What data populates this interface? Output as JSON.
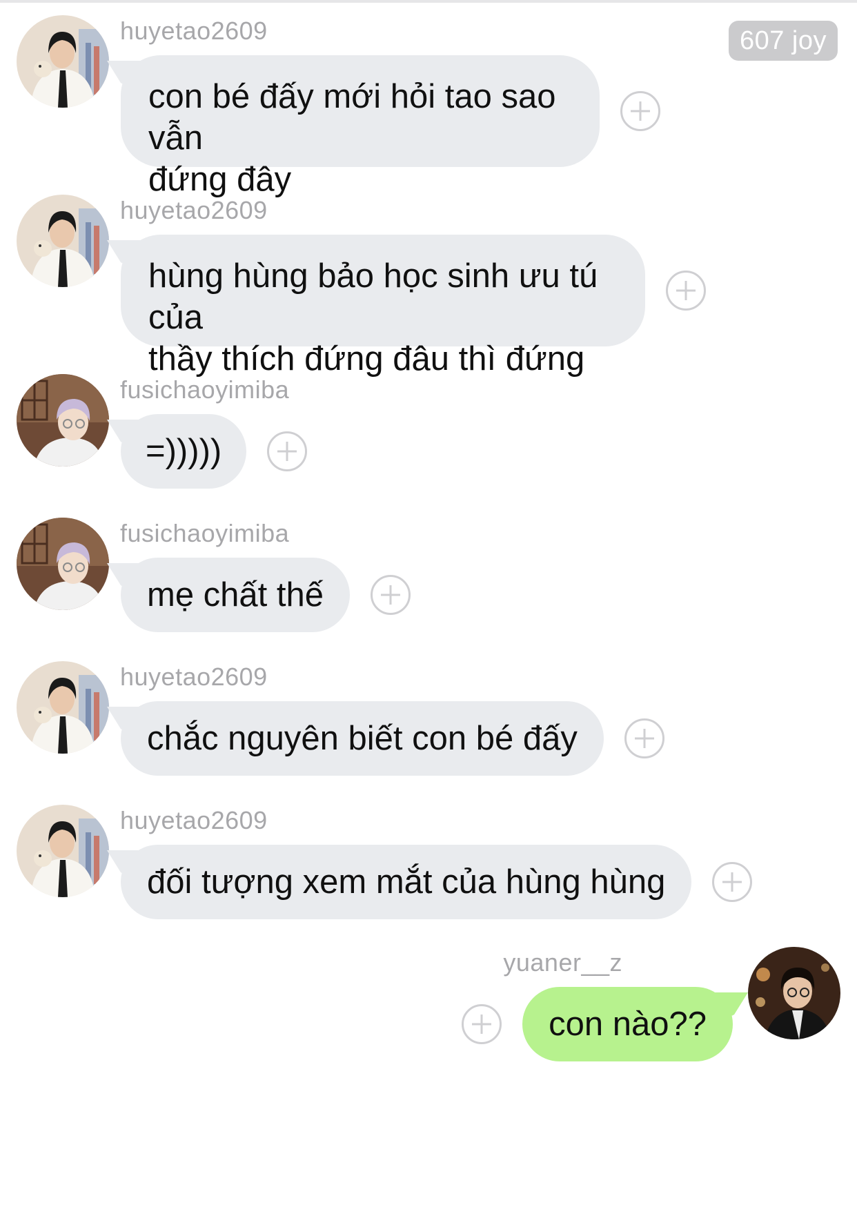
{
  "badge": {
    "text": "607 joy"
  },
  "messages": [
    {
      "sender": "huyetao2609",
      "text": "con bé đấy mới hỏi tao sao vẫn\nđứng đây",
      "side": "left",
      "avatar": "avatar-huyetao"
    },
    {
      "sender": "huyetao2609",
      "text": "hùng hùng bảo học sinh ưu tú của\nthầy thích đứng đâu thì đứng",
      "side": "left",
      "avatar": "avatar-huyetao"
    },
    {
      "sender": "fusichaoyimiba",
      "text": "=)))))",
      "side": "left",
      "avatar": "avatar-fusichao"
    },
    {
      "sender": "fusichaoyimiba",
      "text": "mẹ chất thế",
      "side": "left",
      "avatar": "avatar-fusichao"
    },
    {
      "sender": "huyetao2609",
      "text": "chắc nguyên biết con bé đấy",
      "side": "left",
      "avatar": "avatar-huyetao"
    },
    {
      "sender": "huyetao2609",
      "text": "đối tượng xem mắt của hùng hùng",
      "side": "left",
      "avatar": "avatar-huyetao"
    },
    {
      "sender": "yuaner__z",
      "text": "con nào??",
      "side": "right",
      "avatar": "avatar-yuaner"
    }
  ],
  "colors": {
    "incoming_bubble": "#e9ebee",
    "outgoing_bubble": "#b7f28e",
    "sender_text": "#a7a7aa",
    "badge_bg": "#cbcbcd"
  },
  "icons": {
    "react": "plus-circle-icon"
  }
}
